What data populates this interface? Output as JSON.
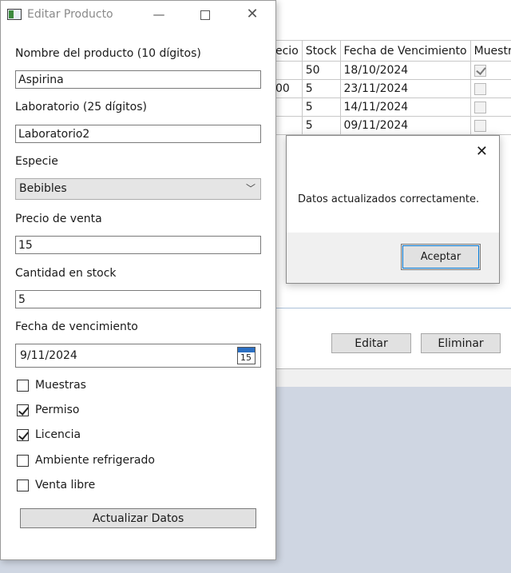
{
  "background_app": {
    "grid": {
      "columns": [
        "ecio",
        "Stock",
        "Fecha de Vencimiento",
        "Muestra"
      ],
      "rows": [
        {
          "precio": "",
          "stock": "50",
          "fecha": "18/10/2024",
          "muestra": true
        },
        {
          "precio": "00",
          "stock": "5",
          "fecha": "23/11/2024",
          "muestra": false
        },
        {
          "precio": "",
          "stock": "5",
          "fecha": "14/11/2024",
          "muestra": false
        },
        {
          "precio": "",
          "stock": "5",
          "fecha": "09/11/2024",
          "muestra": false
        }
      ]
    },
    "edit_button": "Editar",
    "delete_button": "Eliminar"
  },
  "message_box": {
    "message": "Datos actualizados correctamente.",
    "ok_button": "Aceptar"
  },
  "edit_window": {
    "title": "Editar Producto",
    "fields": {
      "nombre_label": "Nombre del producto (10 dígitos)",
      "nombre_value": "Aspirina",
      "laboratorio_label": "Laboratorio (25 dígitos)",
      "laboratorio_value": "Laboratorio2",
      "especie_label": "Especie",
      "especie_value": "Bebibles",
      "precio_label": "Precio de venta",
      "precio_value": "15",
      "cantidad_label": "Cantidad en stock",
      "cantidad_value": "5",
      "fecha_label": "Fecha de vencimiento",
      "fecha_value": "9/11/2024",
      "calendar_day": "15"
    },
    "checkboxes": [
      {
        "label": "Muestras",
        "checked": false
      },
      {
        "label": "Permiso",
        "checked": true
      },
      {
        "label": "Licencia",
        "checked": true
      },
      {
        "label": "Ambiente refrigerado",
        "checked": false
      },
      {
        "label": "Venta libre",
        "checked": false
      }
    ],
    "update_button": "Actualizar Datos"
  }
}
